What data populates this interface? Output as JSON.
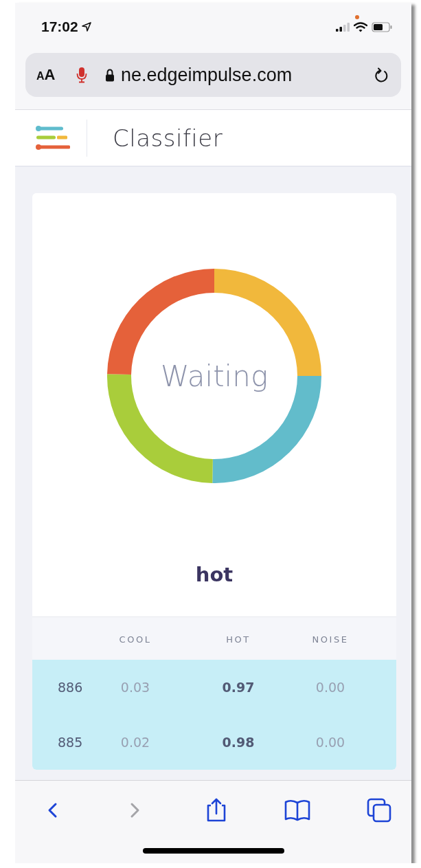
{
  "status_bar": {
    "time": "17:02",
    "recording": true
  },
  "address_bar": {
    "text_size": "AA",
    "url": "ne.edgeimpulse.com"
  },
  "header": {
    "title": "Classifier"
  },
  "classifier": {
    "center_text": "Waiting",
    "label": "hot"
  },
  "table": {
    "columns": [
      "",
      "COOL",
      "HOT",
      "NOISE"
    ],
    "rows": [
      {
        "id": "886",
        "highlighted": true,
        "values": [
          {
            "text": "0.03",
            "top": false
          },
          {
            "text": "0.97",
            "top": true
          },
          {
            "text": "0.00",
            "top": false
          }
        ]
      },
      {
        "id": "885",
        "highlighted": true,
        "values": [
          {
            "text": "0.02",
            "top": false
          },
          {
            "text": "0.98",
            "top": true
          },
          {
            "text": "0.00",
            "top": false
          }
        ]
      }
    ]
  },
  "toolbar": [
    {
      "kind": "back",
      "disabled": false
    },
    {
      "kind": "forward",
      "disabled": true
    },
    {
      "kind": "share",
      "disabled": false
    },
    {
      "kind": "bookmarks",
      "disabled": false
    },
    {
      "kind": "tabs",
      "disabled": false
    }
  ]
}
